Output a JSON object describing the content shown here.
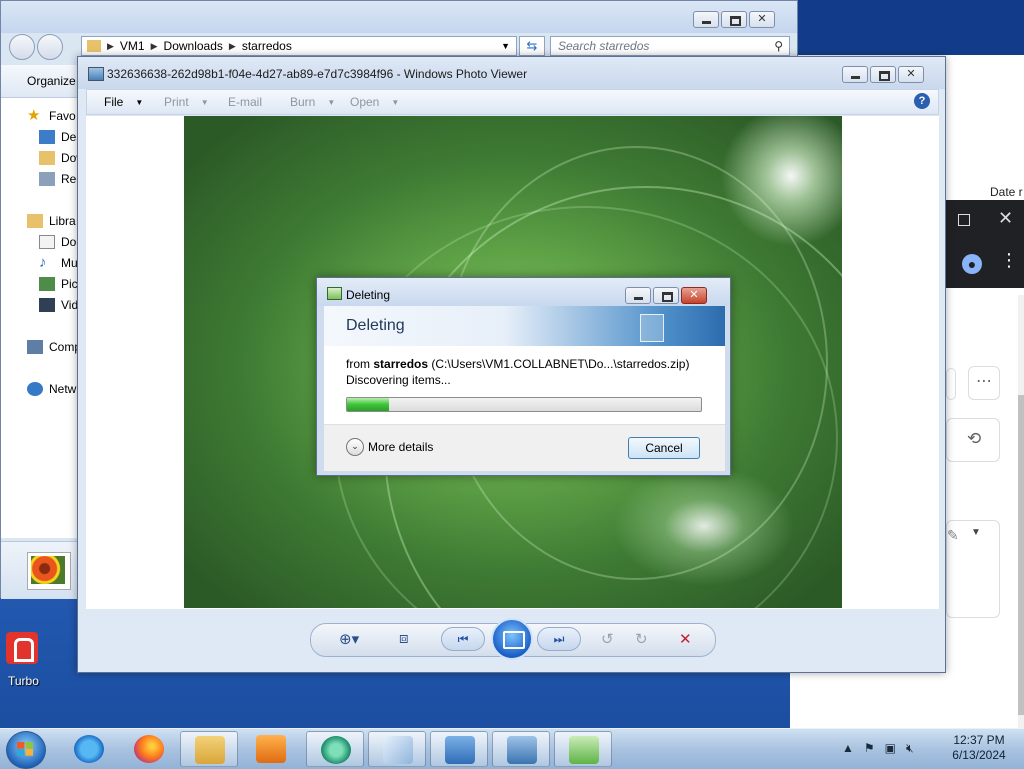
{
  "background_browser": {
    "column_header": "Date r"
  },
  "desktop": {
    "icon_label": "Turbo"
  },
  "explorer": {
    "address": [
      "VM1",
      "Downloads",
      "starredos"
    ],
    "search_placeholder": "Search starredos",
    "toolbar_organize": "Organize",
    "nav": [
      {
        "label": "Favo",
        "icon": "star-icon"
      },
      {
        "label": "Des",
        "icon": "desktop-icon"
      },
      {
        "label": "Dow",
        "icon": "downloads-icon"
      },
      {
        "label": "Rec",
        "icon": "recent-icon"
      },
      {
        "label": "Libra",
        "icon": "library-icon"
      },
      {
        "label": "Doc",
        "icon": "documents-icon"
      },
      {
        "label": "Mu",
        "icon": "music-icon"
      },
      {
        "label": "Pict",
        "icon": "pictures-icon"
      },
      {
        "label": "Vid",
        "icon": "videos-icon"
      },
      {
        "label": "Comp",
        "icon": "computer-icon"
      },
      {
        "label": "Netw",
        "icon": "network-icon"
      }
    ]
  },
  "photo_viewer": {
    "title": "332636638-262d98b1-f04e-4d27-ab89-e7d7c3984f96 - Windows Photo Viewer",
    "menu": {
      "file": "File",
      "print": "Print",
      "email": "E-mail",
      "burn": "Burn",
      "open": "Open"
    },
    "help_label": "?"
  },
  "dialog": {
    "title": "Deleting",
    "heading": "Deleting",
    "from_prefix": "from",
    "from_name": "starredos",
    "from_path": "(C:\\Users\\VM1.COLLABNET\\Do...\\starredos.zip)",
    "status": "Discovering items...",
    "progress_percent": 12,
    "more_details": "More details",
    "cancel": "Cancel"
  },
  "taskbar": {
    "time": "12:37 PM",
    "date": "6/13/2024",
    "colors": {
      "accent": "#1e62b7"
    }
  }
}
